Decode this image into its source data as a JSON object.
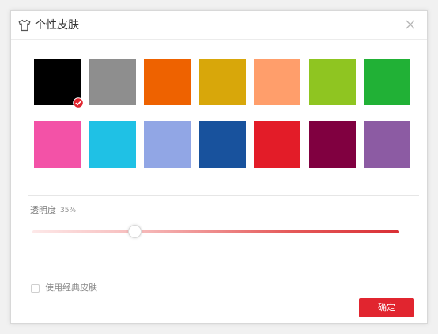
{
  "dialog": {
    "title": "个性皮肤",
    "icons": {
      "title": "tshirt-icon",
      "close": "close-icon",
      "selected": "check-circle-icon"
    }
  },
  "swatches": [
    {
      "color": "#000000",
      "selected": true
    },
    {
      "color": "#8e8e8e",
      "selected": false
    },
    {
      "color": "#ee6200",
      "selected": false
    },
    {
      "color": "#d8a70a",
      "selected": false
    },
    {
      "color": "#ff9e6b",
      "selected": false
    },
    {
      "color": "#8fc521",
      "selected": false
    },
    {
      "color": "#21b136",
      "selected": false
    },
    {
      "color": "#f352a7",
      "selected": false
    },
    {
      "color": "#1fc1e5",
      "selected": false
    },
    {
      "color": "#91a6e5",
      "selected": false
    },
    {
      "color": "#18529d",
      "selected": false
    },
    {
      "color": "#e31c28",
      "selected": false
    },
    {
      "color": "#800040",
      "selected": false
    },
    {
      "color": "#8c5ba3",
      "selected": false
    }
  ],
  "opacity": {
    "label": "透明度",
    "value_text": "35%",
    "value": 0.28
  },
  "classic_skin": {
    "label": "使用经典皮肤",
    "checked": false
  },
  "confirm_label": "确定",
  "colors": {
    "accent": "#e1252f"
  }
}
